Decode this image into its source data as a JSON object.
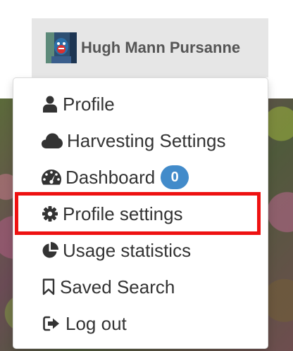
{
  "user": {
    "name": "Hugh Mann Pursanne",
    "avatar_icon": "user-avatar"
  },
  "menu": {
    "items": [
      {
        "label": "Profile",
        "icon": "user-icon"
      },
      {
        "label": "Harvesting Settings",
        "icon": "cloud-icon"
      },
      {
        "label": "Dashboard",
        "icon": "dashboard-icon",
        "badge": "0"
      },
      {
        "label": "Profile settings",
        "icon": "gear-icon"
      },
      {
        "label": "Usage statistics",
        "icon": "pie-chart-icon"
      },
      {
        "label": "Saved Search",
        "icon": "bookmark-icon"
      },
      {
        "label": "Log out",
        "icon": "sign-out-icon"
      }
    ]
  },
  "colors": {
    "badge": "#428bca",
    "highlight": "#ee1111",
    "toggle_bg": "#e6e6e6",
    "text": "#333333"
  }
}
